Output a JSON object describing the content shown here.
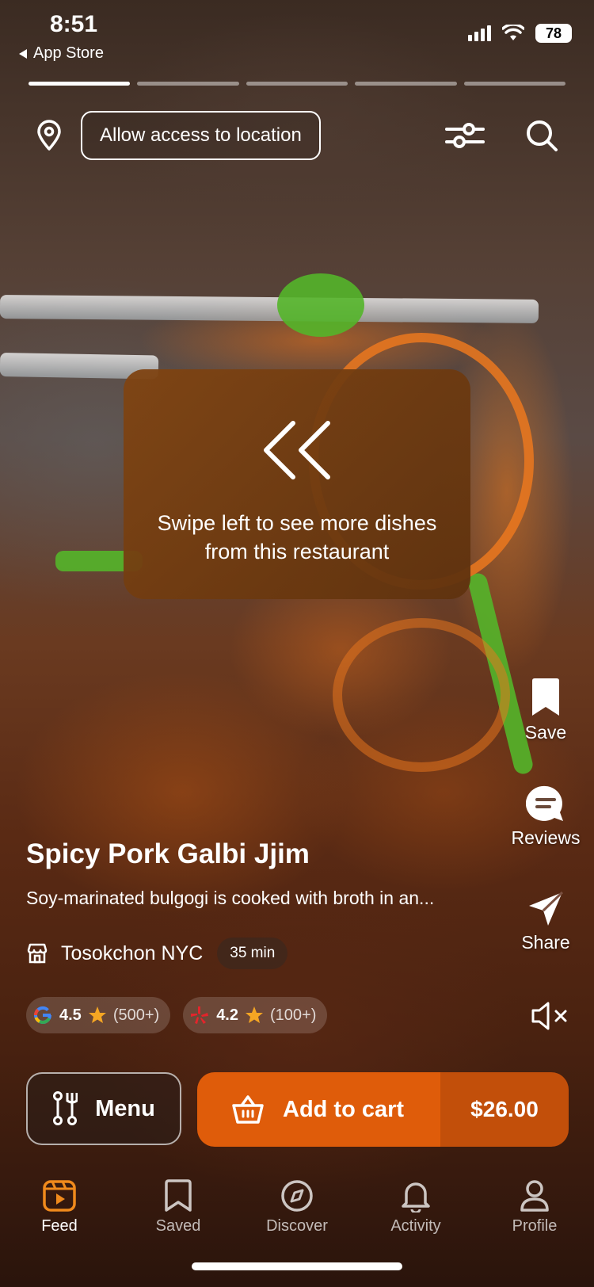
{
  "status": {
    "time": "8:51",
    "back_label": "App Store",
    "battery": "78"
  },
  "top": {
    "location_button": "Allow access to location"
  },
  "hint": {
    "text": "Swipe left to see more dishes from this restaurant"
  },
  "actions": {
    "save": "Save",
    "reviews": "Reviews",
    "share": "Share"
  },
  "dish": {
    "title": "Spicy Pork Galbi Jjim",
    "description": "Soy-marinated bulgogi is cooked with broth in an...",
    "restaurant": "Tosokchon NYC",
    "eta": "35 min",
    "google": {
      "score": "4.5",
      "count": "(500+)"
    },
    "yelp": {
      "score": "4.2",
      "count": "(100+)"
    }
  },
  "buttons": {
    "menu": "Menu",
    "add_to_cart": "Add to cart",
    "price": "$26.00"
  },
  "tabs": [
    {
      "label": "Feed"
    },
    {
      "label": "Saved"
    },
    {
      "label": "Discover"
    },
    {
      "label": "Activity"
    },
    {
      "label": "Profile"
    }
  ],
  "colors": {
    "accent": "#df5c0a",
    "accent_dark": "#c24f0a",
    "star": "#f5a623",
    "yelp": "#e3242b"
  }
}
